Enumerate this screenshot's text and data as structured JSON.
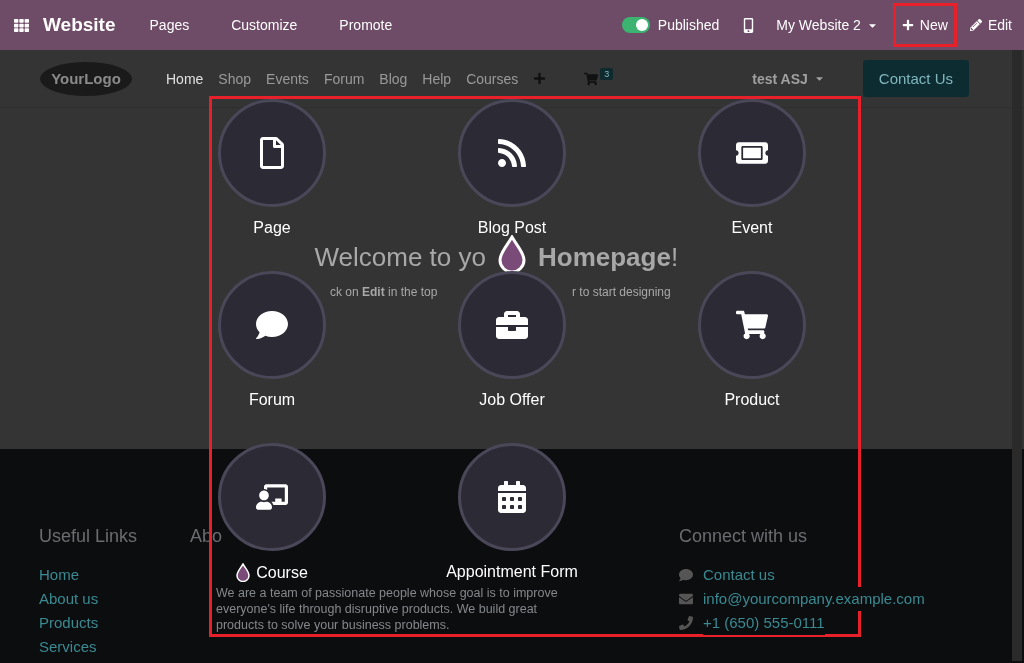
{
  "navbar": {
    "app": "Website",
    "menus": [
      "Pages",
      "Customize",
      "Promote"
    ],
    "published": {
      "label": "Published",
      "on": true
    },
    "website": "My Website 2",
    "new_button": "New",
    "edit_button": "Edit"
  },
  "site_header": {
    "logo": "YourLogo",
    "menu": [
      {
        "label": "Home",
        "selected": true
      },
      {
        "label": "Shop",
        "selected": false
      },
      {
        "label": "Events",
        "selected": false
      },
      {
        "label": "Forum",
        "selected": false
      },
      {
        "label": "Blog",
        "selected": false
      },
      {
        "label": "Help",
        "selected": false
      },
      {
        "label": "Courses",
        "selected": false
      }
    ],
    "cart_count": "3",
    "user": "test ASJ",
    "cta": "Contact Us"
  },
  "hero": {
    "title_parts": [
      "Welcome to yo",
      "**Homepage**!"
    ],
    "subtitle_parts": [
      "ck on **Edit** in the top",
      "r to start designing"
    ]
  },
  "footer": {
    "links_title": "Useful Links",
    "links": [
      "Home",
      "About us",
      "Products",
      "Services"
    ],
    "about_title": "Abo",
    "about_text": "We are a team of passionate people whose goal is to improve everyone's life through disruptive products. We build great products to solve your business problems.",
    "connect_title": "Connect with us",
    "contacts": [
      {
        "kind": "chat",
        "label": "Contact us"
      },
      {
        "kind": "mail",
        "label": "info@yourcompany.example.com"
      },
      {
        "kind": "phone",
        "label": "+1 (650) 555-0111"
      }
    ]
  },
  "new_content_dialog": {
    "options": [
      {
        "kind": "page",
        "label": "Page"
      },
      {
        "kind": "blog",
        "label": "Blog Post"
      },
      {
        "kind": "event",
        "label": "Event"
      },
      {
        "kind": "forum",
        "label": "Forum"
      },
      {
        "kind": "job",
        "label": "Job Offer"
      },
      {
        "kind": "product",
        "label": "Product"
      },
      {
        "kind": "course",
        "label": "Course"
      },
      {
        "kind": "appointment",
        "label": "Appointment Form"
      }
    ]
  }
}
